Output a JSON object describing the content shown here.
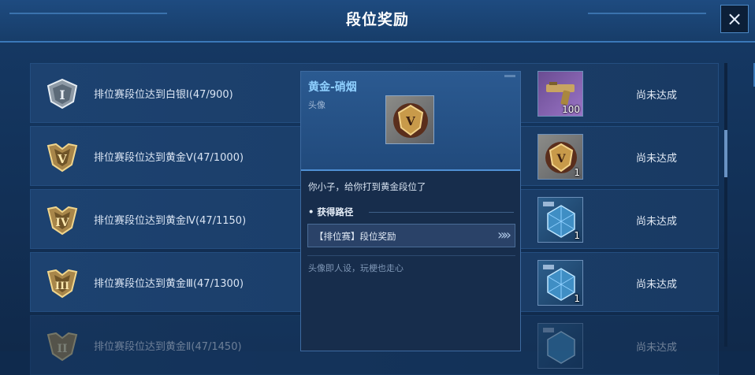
{
  "header": {
    "title": "段位奖励",
    "close_icon": "×"
  },
  "rows": [
    {
      "badge_numeral": "I",
      "badge_color": "#c9d3dc",
      "text": "排位赛段位达到白银Ⅰ(47/900)",
      "reward_icon": "gun-icon",
      "reward_count": "100",
      "status": "尚未达成"
    },
    {
      "badge_numeral": "V",
      "badge_color": "#d9b66a",
      "text": "排位赛段位达到黄金Ⅴ(47/1000)",
      "reward_icon": "gold-avatar-icon",
      "reward_count": "1",
      "status": "尚未达成"
    },
    {
      "badge_numeral": "IV",
      "badge_color": "#d9b66a",
      "text": "排位赛段位达到黄金Ⅳ(47/1150)",
      "reward_icon": "crystal-crate-icon",
      "reward_count": "1",
      "status": "尚未达成"
    },
    {
      "badge_numeral": "III",
      "badge_color": "#d9b66a",
      "text": "排位赛段位达到黄金Ⅲ(47/1300)",
      "reward_icon": "crystal-crate-icon",
      "reward_count": "1",
      "status": "尚未达成"
    },
    {
      "badge_numeral": "II",
      "badge_color": "#d9b66a",
      "text": "排位赛段位达到黄金Ⅱ(47/1450)",
      "reward_icon": "crystal-crate-icon",
      "reward_count": "",
      "status": "尚未达成"
    }
  ],
  "tooltip": {
    "name": "黄金-硝烟",
    "type": "头像",
    "description": "你小子，给你打到黄金段位了",
    "section_title": "• 获得路径",
    "link_label": "【排位赛】段位奖励",
    "link_arrow_icon": "double-chevron-right-icon",
    "flavor": "头像即人设，玩梗也走心"
  },
  "colors": {
    "accent": "#8fd0ff",
    "gold": "#d9b66a",
    "silver": "#c9d3dc",
    "purple_rarity": "#8b62b8"
  }
}
